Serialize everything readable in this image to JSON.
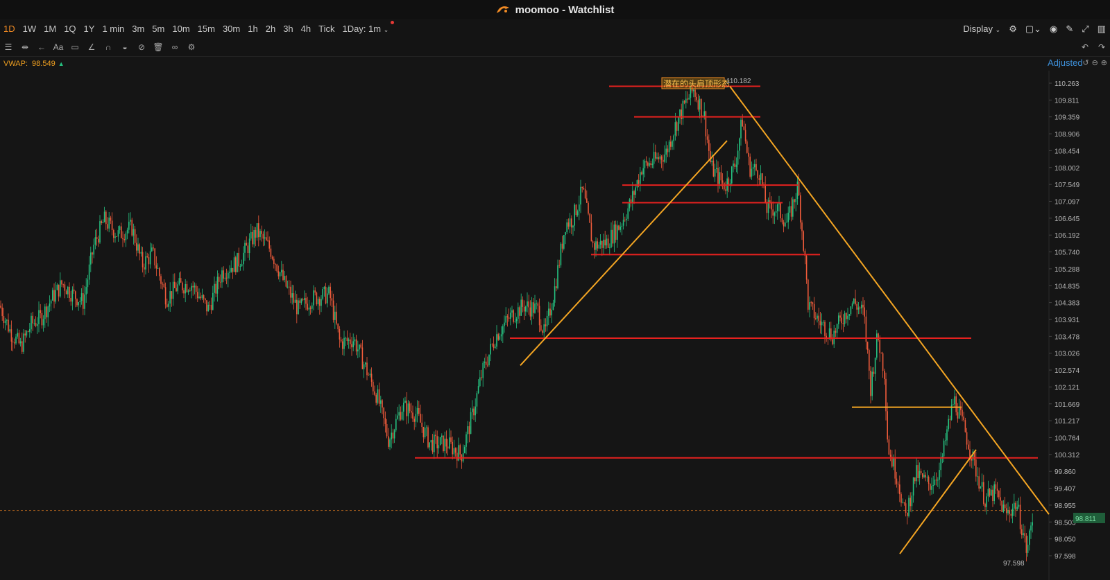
{
  "window": {
    "app_name": "moomoo",
    "title": "moomoo - Watchlist"
  },
  "periods": [
    "1D",
    "1W",
    "1M",
    "1Q",
    "1Y",
    "1 min",
    "3m",
    "5m",
    "10m",
    "15m",
    "30m",
    "1h",
    "2h",
    "3h",
    "4h",
    "Tick"
  ],
  "active_period": "1D",
  "period_dropdown": "1Day: 1m",
  "display_label": "Display",
  "indicator": {
    "name": "VWAP:",
    "value": "98.549"
  },
  "adjusted_label": "Adjusted",
  "annotation": {
    "text": "潜在的头肩顶形态",
    "high_value": "110.182"
  },
  "low_label": "97.598",
  "current_price": "98.811",
  "colors": {
    "up": "#26c281",
    "down": "#ef5b3b",
    "trend": "#f5a623",
    "level": "#e6211f",
    "accent": "#f08a24"
  },
  "chart_data": {
    "type": "candlestick",
    "y_ticks": [
      "110.263",
      "109.811",
      "109.359",
      "108.906",
      "108.454",
      "108.002",
      "107.549",
      "107.097",
      "106.645",
      "106.192",
      "105.740",
      "105.288",
      "104.835",
      "104.383",
      "103.931",
      "103.478",
      "103.026",
      "102.574",
      "102.121",
      "101.669",
      "101.217",
      "100.764",
      "100.312",
      "99.860",
      "99.407",
      "98.955",
      "98.503",
      "98.050",
      "97.598"
    ],
    "ylim": [
      97.4,
      110.55
    ],
    "close_path": [
      [
        0,
        104.3
      ],
      [
        15,
        103.6
      ],
      [
        30,
        103.2
      ],
      [
        45,
        103.8
      ],
      [
        60,
        104.0
      ],
      [
        75,
        104.5
      ],
      [
        90,
        104.9
      ],
      [
        105,
        104.6
      ],
      [
        120,
        104.4
      ],
      [
        135,
        105.9
      ],
      [
        150,
        106.6
      ],
      [
        170,
        106.2
      ],
      [
        190,
        106.4
      ],
      [
        205,
        105.4
      ],
      [
        220,
        105.7
      ],
      [
        240,
        104.5
      ],
      [
        255,
        104.8
      ],
      [
        275,
        104.9
      ],
      [
        300,
        104.2
      ],
      [
        320,
        105.2
      ],
      [
        345,
        105.5
      ],
      [
        370,
        106.3
      ],
      [
        390,
        105.8
      ],
      [
        410,
        104.9
      ],
      [
        430,
        104.2
      ],
      [
        450,
        104.5
      ],
      [
        475,
        104.6
      ],
      [
        490,
        103.3
      ],
      [
        510,
        103.4
      ],
      [
        530,
        102.5
      ],
      [
        545,
        101.8
      ],
      [
        560,
        100.7
      ],
      [
        580,
        101.6
      ],
      [
        600,
        101.4
      ],
      [
        620,
        100.6
      ],
      [
        645,
        100.6
      ],
      [
        665,
        100.3
      ],
      [
        680,
        101.3
      ],
      [
        695,
        102.5
      ],
      [
        715,
        103.5
      ],
      [
        735,
        104.0
      ],
      [
        755,
        104.3
      ],
      [
        775,
        104.2
      ],
      [
        785,
        103.5
      ],
      [
        800,
        104.8
      ],
      [
        815,
        106.5
      ],
      [
        825,
        106.6
      ],
      [
        840,
        107.4
      ],
      [
        855,
        105.9
      ],
      [
        875,
        106.0
      ],
      [
        895,
        106.5
      ],
      [
        910,
        107.1
      ],
      [
        925,
        108.0
      ],
      [
        945,
        108.2
      ],
      [
        960,
        108.4
      ],
      [
        975,
        109.2
      ],
      [
        990,
        109.8
      ],
      [
        1000,
        110.1
      ],
      [
        1015,
        109.4
      ],
      [
        1025,
        108.0
      ],
      [
        1045,
        107.5
      ],
      [
        1060,
        108.1
      ],
      [
        1070,
        109.3
      ],
      [
        1080,
        108.0
      ],
      [
        1095,
        107.9
      ],
      [
        1105,
        106.9
      ],
      [
        1120,
        106.9
      ],
      [
        1135,
        106.5
      ],
      [
        1150,
        107.5
      ],
      [
        1160,
        105.6
      ],
      [
        1165,
        104.3
      ],
      [
        1180,
        103.9
      ],
      [
        1200,
        103.5
      ],
      [
        1215,
        104.0
      ],
      [
        1230,
        104.4
      ],
      [
        1245,
        104.1
      ],
      [
        1255,
        102.1
      ],
      [
        1265,
        103.5
      ],
      [
        1275,
        102.5
      ],
      [
        1280,
        100.5
      ],
      [
        1295,
        99.6
      ],
      [
        1305,
        98.6
      ],
      [
        1320,
        99.8
      ],
      [
        1340,
        99.5
      ],
      [
        1355,
        99.9
      ],
      [
        1365,
        100.9
      ],
      [
        1375,
        101.8
      ],
      [
        1390,
        101.0
      ],
      [
        1405,
        100.0
      ],
      [
        1420,
        99.1
      ],
      [
        1435,
        99.3
      ],
      [
        1450,
        98.7
      ],
      [
        1465,
        99.0
      ],
      [
        1475,
        98.2
      ],
      [
        1480,
        97.7
      ],
      [
        1490,
        98.81
      ]
    ],
    "horizontal_levels": [
      {
        "price": 110.18,
        "x1": 878,
        "x2": 1096,
        "color": "level"
      },
      {
        "price": 109.36,
        "x1": 914,
        "x2": 1096,
        "color": "level"
      },
      {
        "price": 107.53,
        "x1": 897,
        "x2": 1150,
        "color": "level"
      },
      {
        "price": 107.06,
        "x1": 897,
        "x2": 1128,
        "color": "level"
      },
      {
        "price": 105.67,
        "x1": 852,
        "x2": 1182,
        "color": "level"
      },
      {
        "price": 103.43,
        "x1": 735,
        "x2": 1400,
        "color": "level"
      },
      {
        "price": 101.58,
        "x1": 1228,
        "x2": 1386,
        "color": "trend"
      },
      {
        "price": 100.22,
        "x1": 598,
        "x2": 1496,
        "color": "level"
      }
    ],
    "trend_lines": [
      {
        "x1": 750,
        "y1": 102.7,
        "x2": 1048,
        "y2": 108.72
      },
      {
        "x1": 1052,
        "y1": 110.18,
        "x2": 1512,
        "y2": 98.71
      },
      {
        "x1": 1297,
        "y1": 97.65,
        "x2": 1407,
        "y2": 100.44
      }
    ]
  }
}
